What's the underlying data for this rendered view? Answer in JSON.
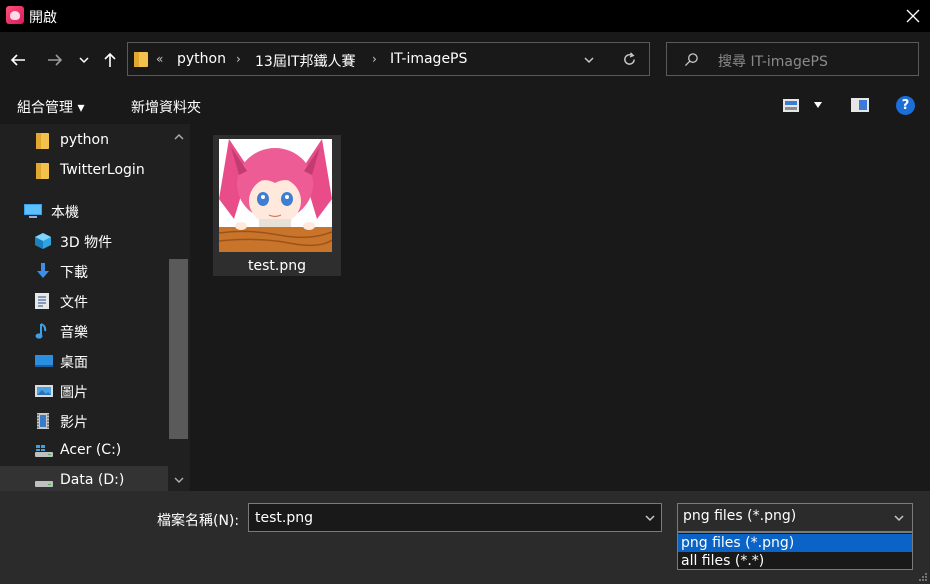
{
  "window": {
    "title": "開啟"
  },
  "breadcrumb": {
    "overflow": "«",
    "items": [
      "python",
      "13屆IT邦鐵人賽",
      "IT-imagePS"
    ]
  },
  "search": {
    "placeholder": "搜尋 IT-imagePS"
  },
  "toolbar": {
    "organize": "組合管理 ▾",
    "new_folder": "新增資料夾"
  },
  "sidebar": {
    "items": [
      {
        "label": "python",
        "icon": "folder-icon"
      },
      {
        "label": "TwitterLogin",
        "icon": "folder-icon"
      },
      {
        "label": "本機",
        "icon": "computer-icon"
      },
      {
        "label": "3D 物件",
        "icon": "cube-icon"
      },
      {
        "label": "下載",
        "icon": "download-icon"
      },
      {
        "label": "文件",
        "icon": "document-icon"
      },
      {
        "label": "音樂",
        "icon": "music-icon"
      },
      {
        "label": "桌面",
        "icon": "desktop-icon"
      },
      {
        "label": "圖片",
        "icon": "pictures-icon"
      },
      {
        "label": "影片",
        "icon": "video-icon"
      },
      {
        "label": "Acer (C:)",
        "icon": "drive-c-icon"
      },
      {
        "label": "Data (D:)",
        "icon": "drive-d-icon"
      }
    ]
  },
  "files": [
    {
      "name": "test.png"
    }
  ],
  "filename": {
    "label": "檔案名稱(N):",
    "value": "test.png"
  },
  "filetype": {
    "selected": "png files (*.png)",
    "options": [
      "png files (*.png)",
      "all files (*.*)"
    ]
  },
  "colors": {
    "accent": "#0a64c8",
    "help": "#1a6fd8",
    "folder": "#f2c14e"
  }
}
